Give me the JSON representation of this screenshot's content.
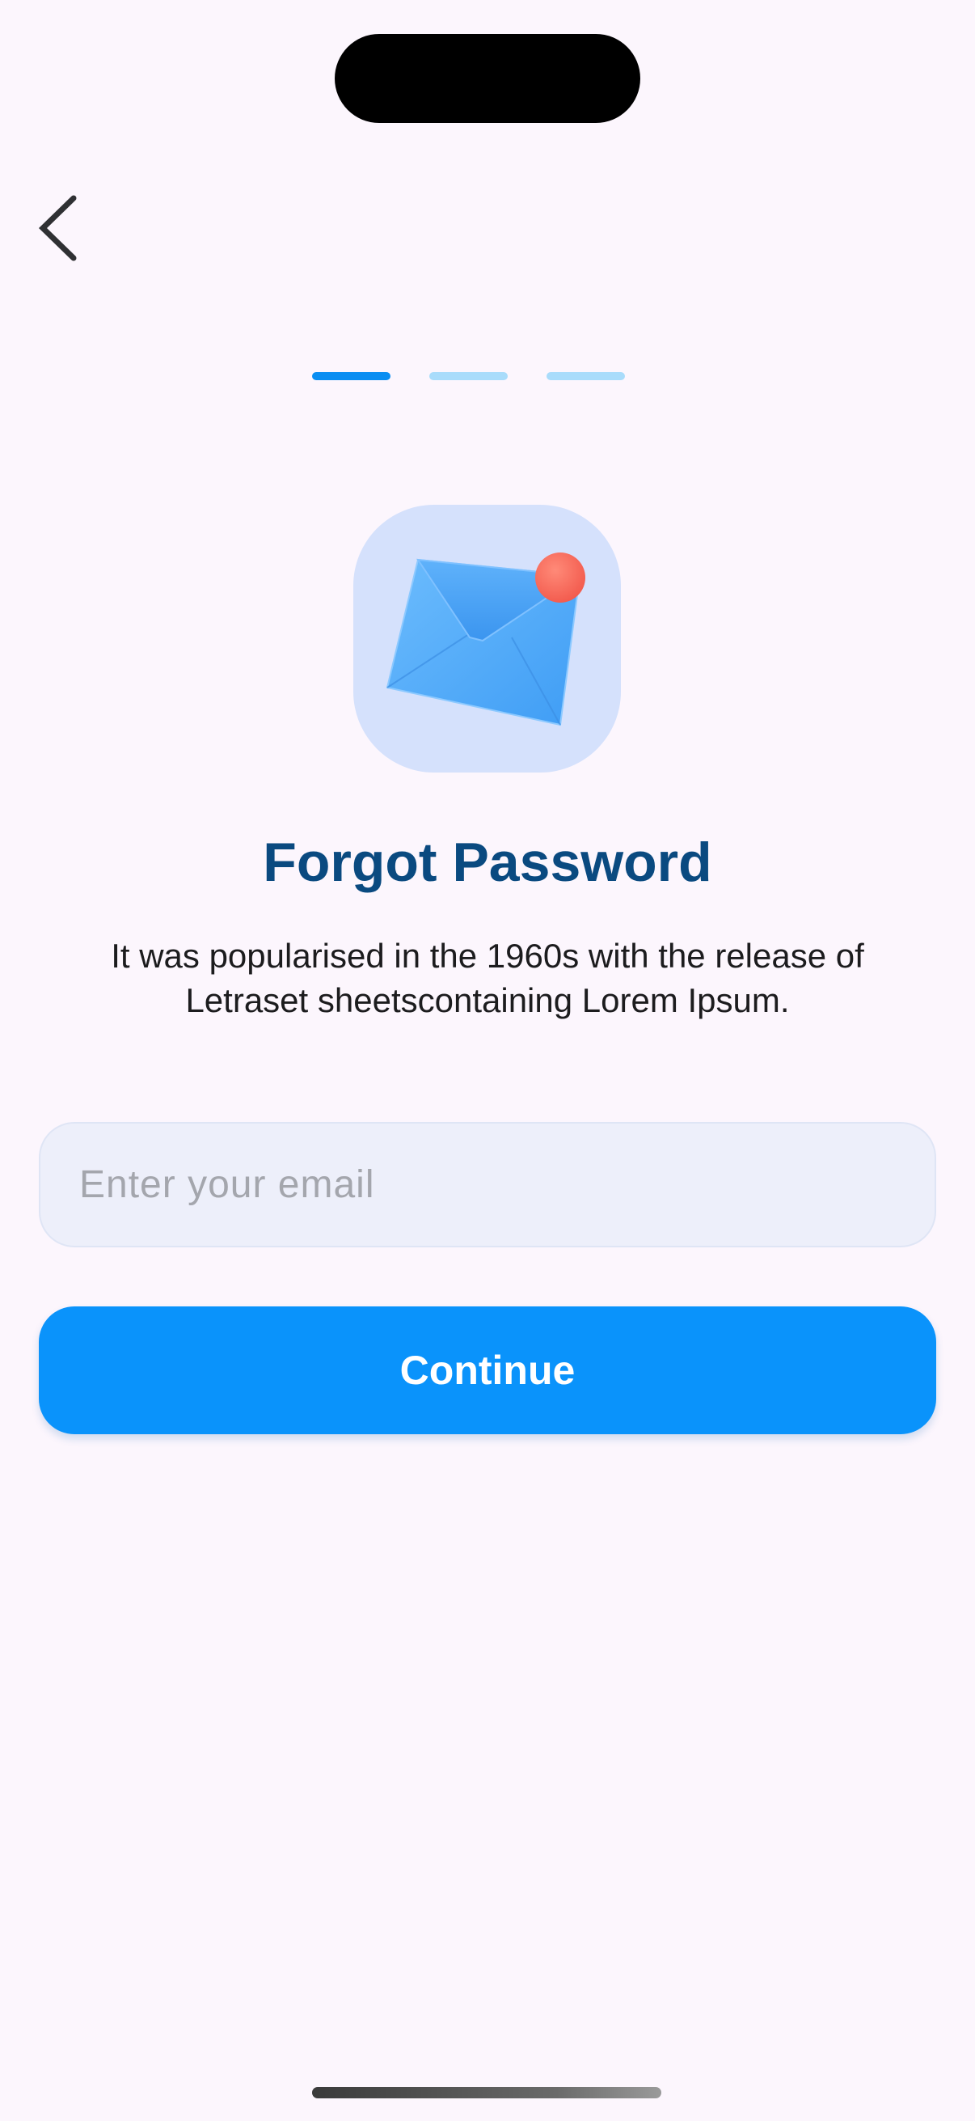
{
  "header": {
    "back_icon": "chevron-left-icon"
  },
  "stepper": {
    "total_steps": 3,
    "current_step": 1,
    "colors": {
      "active": "#0a8ef2",
      "inactive": "#a9dcfb"
    }
  },
  "hero": {
    "icon": "envelope-notification-icon",
    "tile_color": "#d5e1fc",
    "envelope_color": "#4ca7f8",
    "badge_color": "#f96b5e"
  },
  "content": {
    "title": "Forgot Password",
    "description": "It was popularised in the 1960s with the release of Letraset sheetscontaining Lorem Ipsum."
  },
  "form": {
    "email_placeholder": "Enter your email",
    "email_value": "",
    "continue_label": "Continue"
  },
  "colors": {
    "background": "#fcf6fd",
    "title": "#0a4a80",
    "primary": "#0a93fb"
  }
}
